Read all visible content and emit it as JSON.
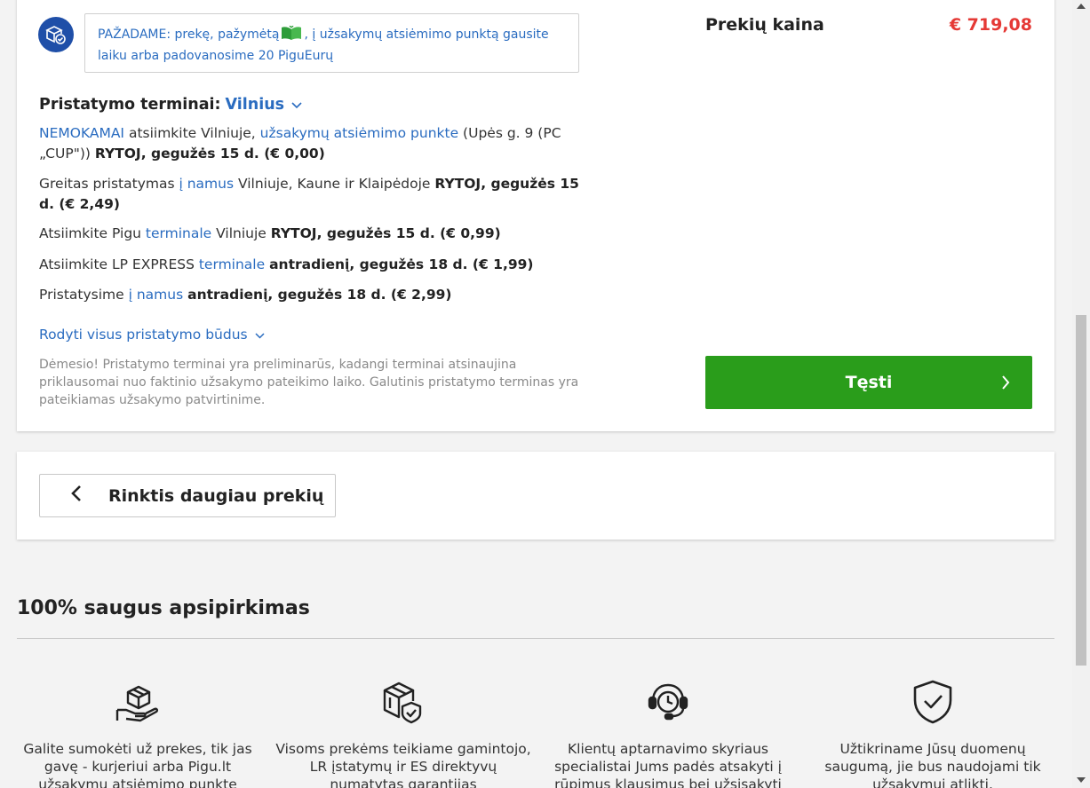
{
  "promise": {
    "text_before": "PAŽADAME: prekę, pažymėtą",
    "text_after": ", į užsakymų atsiėmimo punktą gausite laiku arba padovanosime 20 PiguEurų",
    "icon": "box-check-icon",
    "leaf_icon": "green-book-icon"
  },
  "delivery": {
    "title": "Pristatymo terminai:",
    "city": "Vilnius",
    "options": [
      {
        "p1": "NEMOKAMAI",
        "p2": " atsiimkite Vilniuje, ",
        "p3": "užsakymų atsiėmimo punkte",
        "p4": " (Upės g. 9 (PC „CUP\")) ",
        "p5": "RYTOJ, gegužės 15 d. (€ 0,00)"
      },
      {
        "p1": "Greitas pristatymas ",
        "p2": "į namus",
        "p3": " Vilniuje, Kaune ir Klaipėdoje ",
        "p4": "RYTOJ, gegužės 15 d. (€ 2,49)"
      },
      {
        "p1": "Atsiimkite Pigu ",
        "p2": "terminale",
        "p3": " Vilniuje ",
        "p4": "RYTOJ, gegužės 15 d. (€ 0,99)"
      },
      {
        "p1": "Atsiimkite LP EXPRESS ",
        "p2": "terminale",
        "p3": " ",
        "p4": "antradienį, gegužės 18 d. (€ 1,99)"
      },
      {
        "p1": "Pristatysime ",
        "p2": "į namus",
        "p3": " ",
        "p4": "antradienį, gegužės 18 d. (€ 2,99)"
      }
    ],
    "show_all": "Rodyti visus pristatymo būdus",
    "note": "Dėmesio! Pristatymo terminai yra preliminarūs, kadangi terminai atsinaujina priklausomai nuo faktinio užsakymo pateikimo laiko. Galutinis pristatymo terminas yra pateikiamas užsakymo patvirtinime."
  },
  "summary": {
    "price_label": "Prekių kaina",
    "price_value": "€ 719,08",
    "continue_label": "Tęsti"
  },
  "back": {
    "label": "Rinktis daugiau prekių"
  },
  "safe": {
    "title": "100% saugus apsipirkimas",
    "features": [
      {
        "icon": "hand-box-icon",
        "text": "Galite sumokėti už prekes, tik jas gavę - kurjeriui arba Pigu.lt užsakymų atsiėmimo punkte"
      },
      {
        "icon": "box-shield-icon",
        "text": "Visoms prekėms teikiame gamintojo, LR įstatymų ir ES direktyvų numatytas garantijas"
      },
      {
        "icon": "headset-clock-icon",
        "text": "Klientų aptarnavimo skyriaus specialistai Jums padės atsakyti į rūpimus klausimus bei užsisakyti"
      },
      {
        "icon": "shield-check-icon",
        "text": "Užtikriname Jūsų duomenų saugumą, jie bus naudojami tik užsakymui atlikti."
      }
    ]
  },
  "colors": {
    "accent_blue": "#2a6cc0",
    "price_red": "#e53935",
    "button_green": "#2a9d1b"
  }
}
